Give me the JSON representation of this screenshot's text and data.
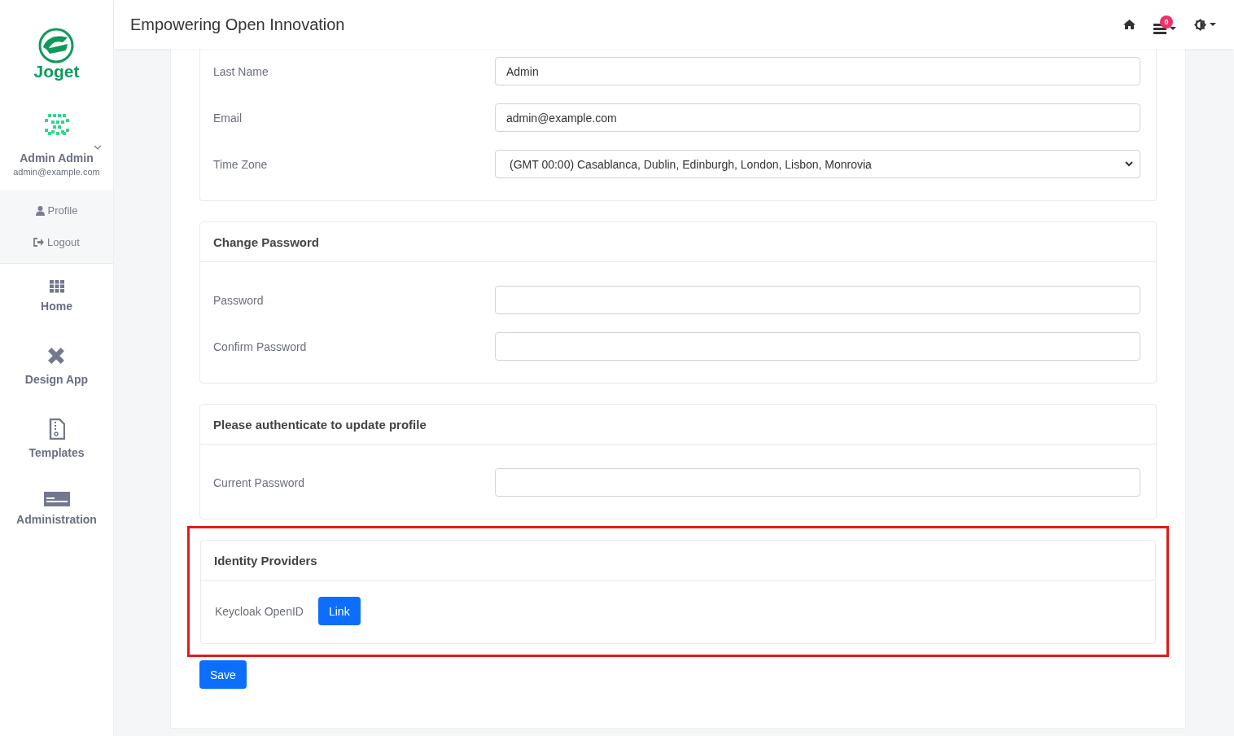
{
  "header": {
    "title": "Empowering Open Innovation",
    "notification_count": "0"
  },
  "sidebar": {
    "logo_text": "Joget",
    "user": {
      "name": "Admin Admin",
      "email": "admin@example.com"
    },
    "user_menu": [
      {
        "label": "Profile"
      },
      {
        "label": "Logout"
      }
    ],
    "nav": [
      {
        "label": "Home"
      },
      {
        "label": "Design App"
      },
      {
        "label": "Templates"
      },
      {
        "label": "Administration"
      }
    ]
  },
  "sections": [
    {
      "kind": "fields",
      "highlighted": false,
      "fields": [
        {
          "label": "Last Name",
          "kind": "text",
          "value": "Admin"
        },
        {
          "label": "Email",
          "kind": "text",
          "value": "admin@example.com"
        },
        {
          "label": "Time Zone",
          "kind": "select",
          "value": "(GMT 00:00) Casablanca, Dublin, Edinburgh, London, Lisbon, Monrovia"
        }
      ]
    },
    {
      "kind": "fields",
      "title": "Change Password",
      "highlighted": false,
      "fields": [
        {
          "label": "Password",
          "kind": "password"
        },
        {
          "label": "Confirm Password",
          "kind": "password"
        }
      ]
    },
    {
      "kind": "fields",
      "title": "Please authenticate to update profile",
      "highlighted": false,
      "fields": [
        {
          "label": "Current Password",
          "kind": "password"
        }
      ]
    },
    {
      "kind": "providers",
      "title": "Identity Providers",
      "highlighted": true,
      "providers": [
        {
          "name": "Keycloak OpenID",
          "action": "Link"
        }
      ]
    }
  ],
  "save_button": "Save"
}
